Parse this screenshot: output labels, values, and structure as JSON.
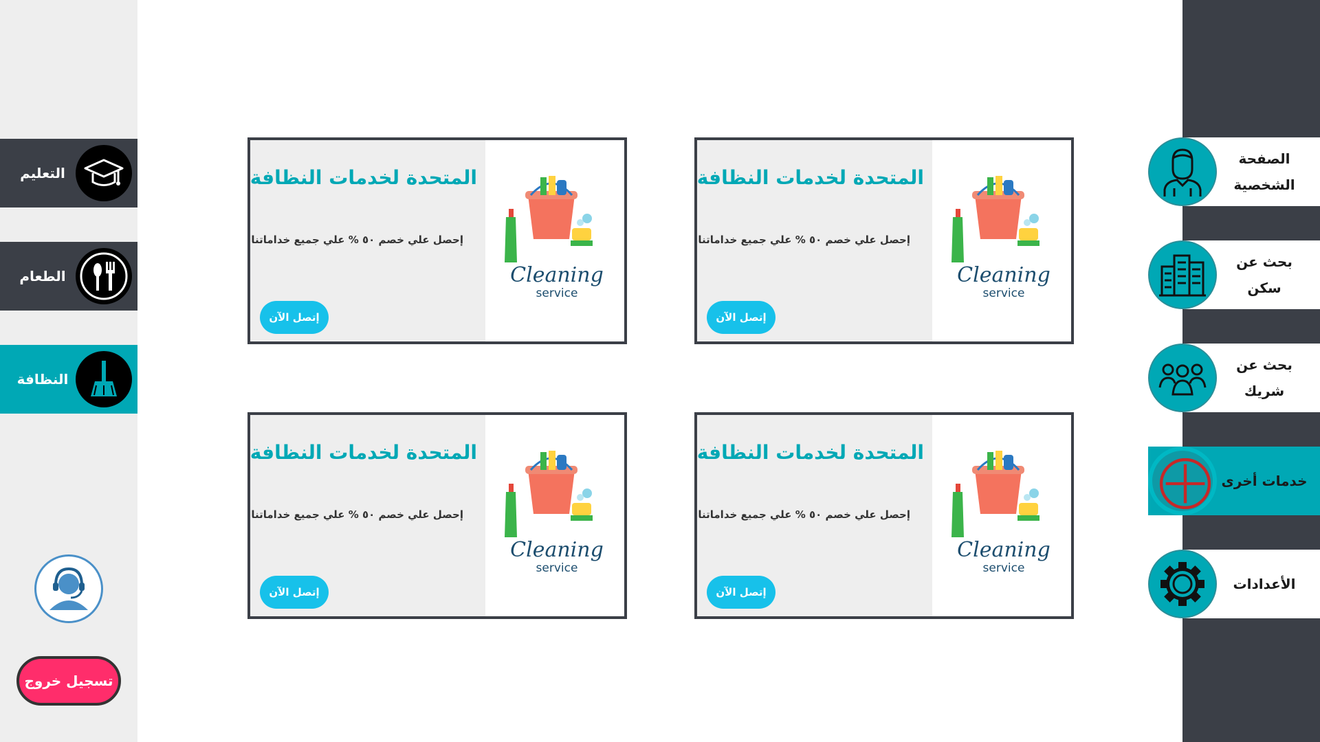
{
  "categories": [
    {
      "label": "التعليم",
      "icon": "graduation-cap-icon",
      "active": false
    },
    {
      "label": "الطعام",
      "icon": "fork-spoon-icon",
      "active": false
    },
    {
      "label": "النظافة",
      "icon": "broom-icon",
      "active": true
    }
  ],
  "logout_label": "تسجيل خروج",
  "support_icon": "support-agent-icon",
  "nav": [
    {
      "label": "الصفحة الشخصية",
      "icon": "user-profile-icon"
    },
    {
      "label": "بحث عن سكن",
      "icon": "buildings-icon"
    },
    {
      "label": "بحث عن شريك",
      "icon": "people-group-icon"
    },
    {
      "label": "خدمات أخرى",
      "icon": "plus-circle-icon"
    },
    {
      "label": "الأعدادات",
      "icon": "gear-icon"
    }
  ],
  "cards": [
    {
      "title": "المتحدة لخدمات النظافة",
      "desc": "إحصل علي خصم ٥٠ % علي جميع خداماتنا",
      "button": "إتصل الآن",
      "logo_word": "Cleaning",
      "logo_sub": "service"
    },
    {
      "title": "المتحدة لخدمات النظافة",
      "desc": "إحصل علي خصم ٥٠ % علي جميع خداماتنا",
      "button": "إتصل الآن",
      "logo_word": "Cleaning",
      "logo_sub": "service"
    },
    {
      "title": "المتحدة لخدمات النظافة",
      "desc": "إحصل علي خصم ٥٠ % علي جميع خداماتنا",
      "button": "إتصل الآن",
      "logo_word": "Cleaning",
      "logo_sub": "service"
    },
    {
      "title": "المتحدة لخدمات النظافة",
      "desc": "إحصل علي خصم ٥٠ % علي جميع خداماتنا",
      "button": "إتصل الآن",
      "logo_word": "Cleaning",
      "logo_sub": "service"
    }
  ],
  "colors": {
    "accent": "#00a8b5",
    "dark": "#3b3f47",
    "logout": "#ff2d6b",
    "call_button": "#17c1ea"
  }
}
